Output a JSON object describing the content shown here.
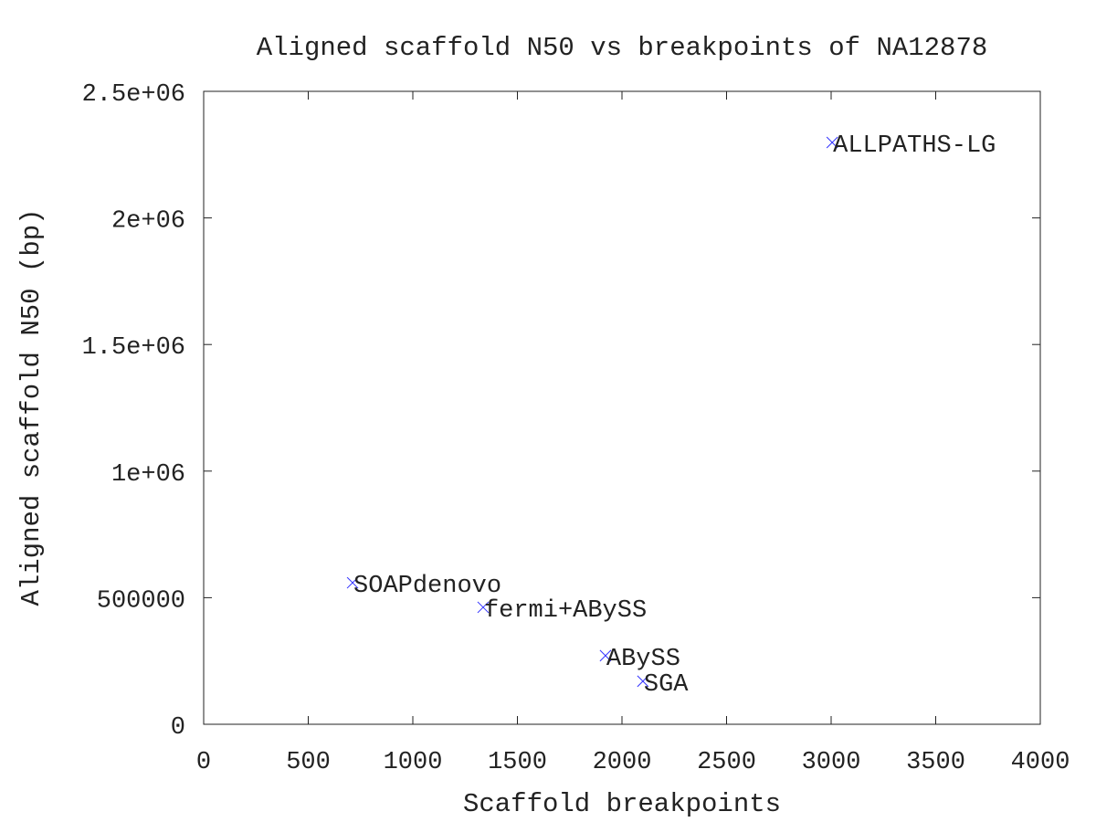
{
  "chart_data": {
    "type": "scatter",
    "title": "Aligned scaffold N50 vs breakpoints of NA12878",
    "xlabel": "Scaffold breakpoints",
    "ylabel": "Aligned scaffold N50 (bp)",
    "xlim": [
      0,
      4000
    ],
    "ylim": [
      0,
      2500000
    ],
    "xticks": [
      0,
      500,
      1000,
      1500,
      2000,
      2500,
      3000,
      3500,
      4000
    ],
    "xtick_labels": [
      "0",
      "500",
      "1000",
      "1500",
      "2000",
      "2500",
      "3000",
      "3500",
      "4000"
    ],
    "yticks": [
      0,
      500000,
      1000000,
      1500000,
      2000000,
      2500000
    ],
    "ytick_labels": [
      "0",
      "500000",
      "1e+06",
      "1.5e+06",
      "2e+06",
      "2.5e+06"
    ],
    "grid": false,
    "legend": "none",
    "marker": "x",
    "marker_color": "#3333ff",
    "points": [
      {
        "label": "ALLPATHS-LG",
        "x": 3005,
        "y": 2298000
      },
      {
        "label": "SOAPdenovo",
        "x": 712,
        "y": 559000
      },
      {
        "label": "fermi+ABySS",
        "x": 1336,
        "y": 462000
      },
      {
        "label": "ABySS",
        "x": 1921,
        "y": 271000
      },
      {
        "label": "SGA",
        "x": 2100,
        "y": 170000
      }
    ]
  }
}
